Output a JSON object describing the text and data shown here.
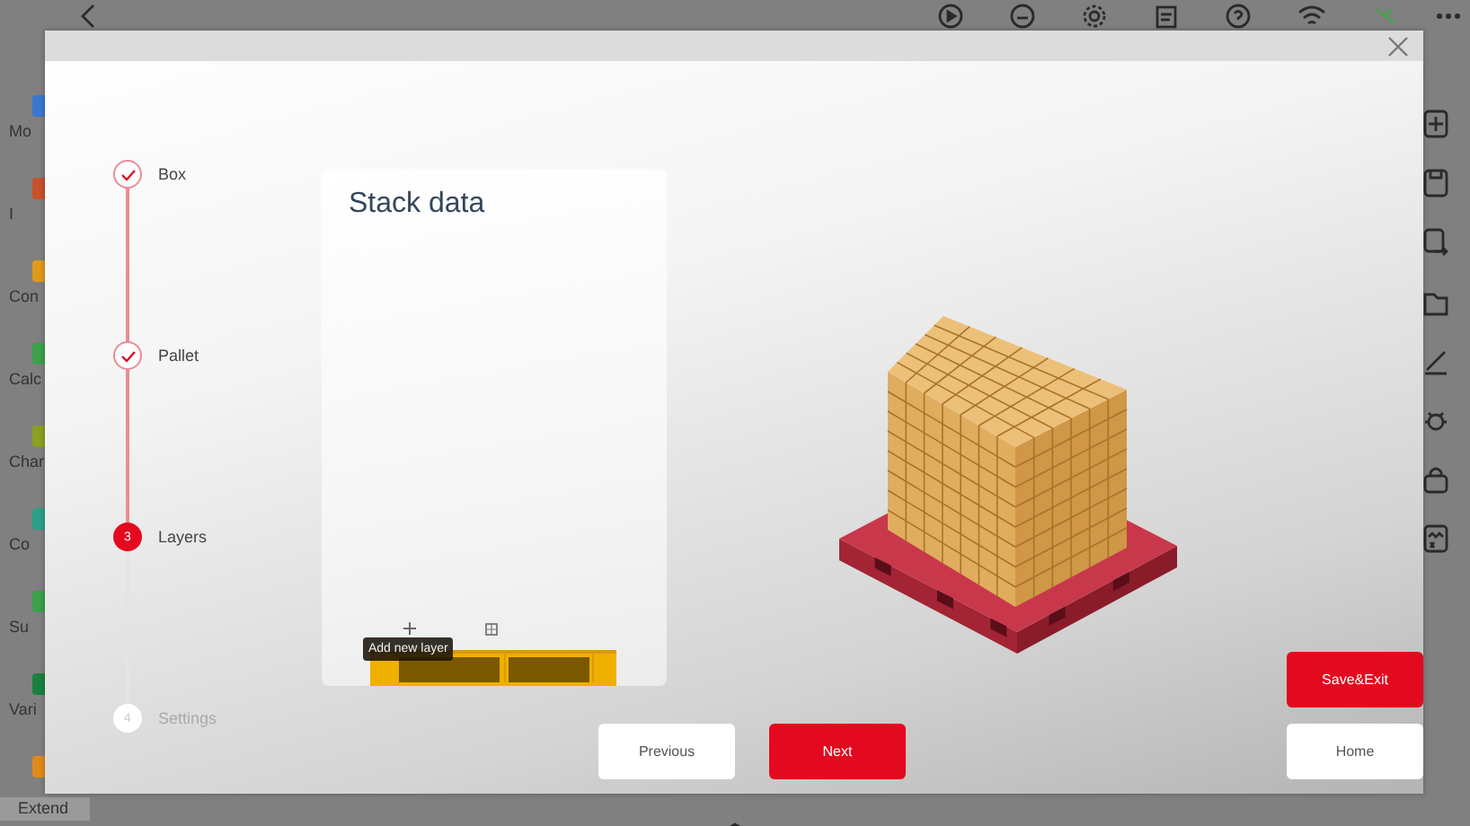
{
  "app_sidebar": [
    {
      "label": "Mo",
      "color": "#3a78d0"
    },
    {
      "label": "I",
      "color": "#c8502a"
    },
    {
      "label": "Con",
      "color": "#e09a1a"
    },
    {
      "label": "Calc",
      "color": "#3aa04a"
    },
    {
      "label": "Char",
      "color": "#8aa020"
    },
    {
      "label": "Co",
      "color": "#2aa088"
    },
    {
      "label": "Su",
      "color": "#3aa04a"
    },
    {
      "label": "Vari",
      "color": "#1a8040"
    },
    {
      "label": "Extend",
      "color": "#e08a1a"
    }
  ],
  "wizard": {
    "steps": [
      {
        "label": "Box",
        "completed": true,
        "selected": false
      },
      {
        "label": "Pallet",
        "completed": true,
        "selected": false
      },
      {
        "label": "Layers",
        "completed": false,
        "selected": true,
        "number": "3"
      },
      {
        "label": "Settings",
        "completed": false,
        "selected": false,
        "number": "4"
      }
    ],
    "stack_card": {
      "title": "Stack data",
      "tooltip": "Add new layer"
    },
    "buttons": [
      {
        "label": "Previous",
        "kind": "secondary"
      },
      {
        "label": "Next",
        "kind": "primary"
      },
      {
        "label": "Save&Exit",
        "kind": "primary"
      },
      {
        "label": "Home",
        "kind": "secondary"
      }
    ]
  }
}
